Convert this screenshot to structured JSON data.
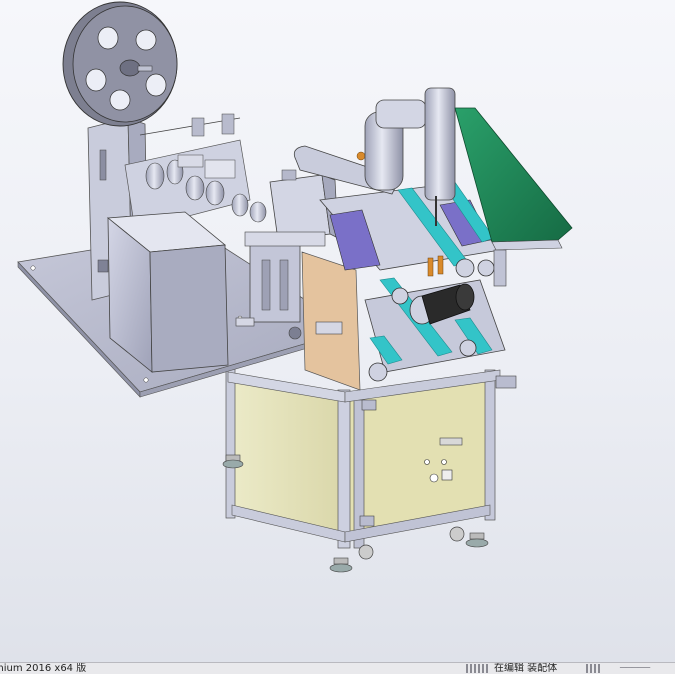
{
  "status_bar": {
    "product": "mium 2016 x64 版",
    "mode": "在编辑 装配体",
    "units": "─────"
  },
  "colors": {
    "frame": "#c8cbdc",
    "sheet": "#b4b7c9",
    "panel_yellow": "#e9e6bd",
    "panel_wood": "#e7c9a6",
    "conveyor_green": "#1f8a5a",
    "belt_teal": "#33c4c8",
    "motor_dark": "#2a2a2a",
    "accent_purple": "#7a70c8",
    "accent_orange": "#d98a2b"
  }
}
